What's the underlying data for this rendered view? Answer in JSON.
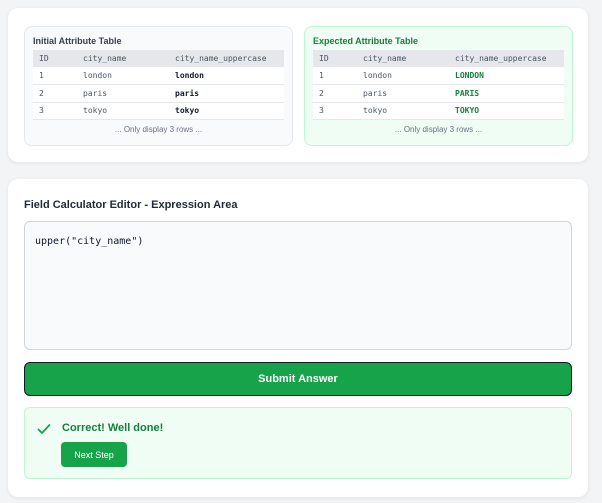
{
  "initial_table": {
    "title": "Initial Attribute Table",
    "columns": [
      "ID",
      "city_name",
      "city_name_uppercase"
    ],
    "rows": [
      [
        "1",
        "london",
        "london"
      ],
      [
        "2",
        "paris",
        "paris"
      ],
      [
        "3",
        "tokyo",
        "tokyo"
      ]
    ],
    "note": "... Only display 3 rows ..."
  },
  "expected_table": {
    "title": "Expected Attribute Table",
    "columns": [
      "ID",
      "city_name",
      "city_name_uppercase"
    ],
    "rows": [
      [
        "1",
        "london",
        "LONDON"
      ],
      [
        "2",
        "paris",
        "PARIS"
      ],
      [
        "3",
        "tokyo",
        "TOKYO"
      ]
    ],
    "note": "... Only display 3 rows ..."
  },
  "editor": {
    "title": "Field Calculator Editor - Expression Area",
    "expression": "upper(\"city_name\")"
  },
  "submit_label": "Submit Answer",
  "feedback": {
    "message": "Correct! Well done!",
    "next_label": "Next Step",
    "icon": "check-icon"
  },
  "colors": {
    "accent": "#16a34a",
    "success_text": "#15803d",
    "success_bg": "#f0fdf4"
  }
}
